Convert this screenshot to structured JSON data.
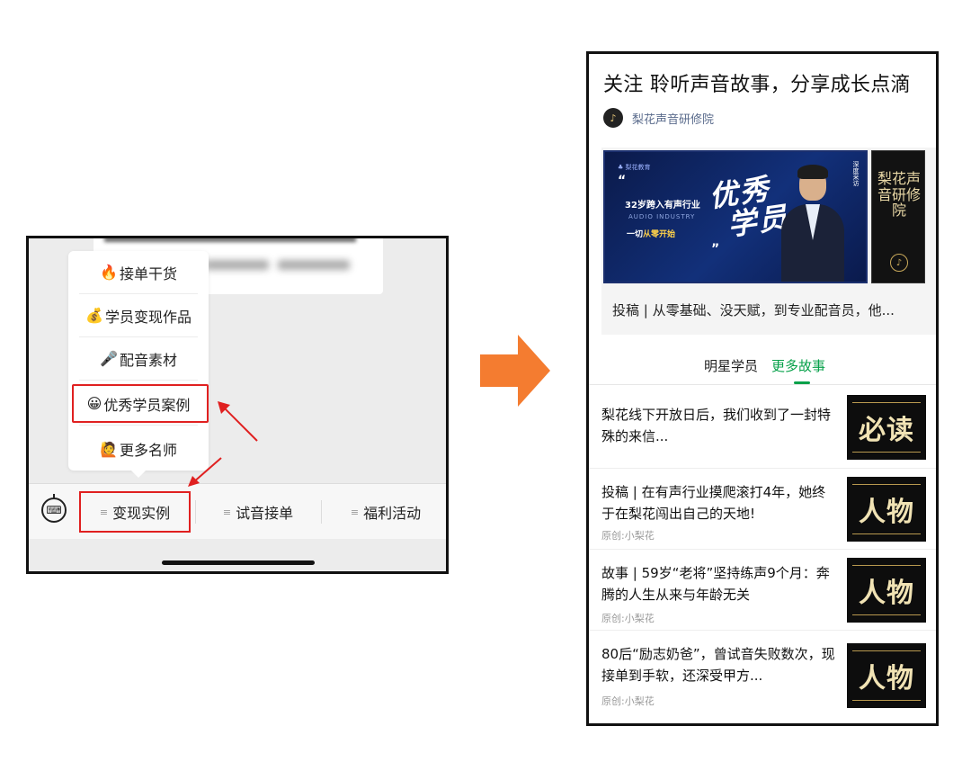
{
  "left_panel": {
    "menu_items": [
      {
        "icon": "🔥",
        "icon_name": "fire-icon",
        "label": "接单干货"
      },
      {
        "icon": "💰",
        "icon_name": "money-bag-icon",
        "label": "学员变现作品"
      },
      {
        "icon": "🎤",
        "icon_name": "microphone-icon",
        "label": "配音素材"
      },
      {
        "icon": "😀",
        "icon_name": "grinning-face-icon",
        "label": "优秀学员案例"
      },
      {
        "icon": "🙋",
        "icon_name": "person-raising-hand-icon",
        "label": "更多名师"
      }
    ],
    "bottom_tabs": [
      {
        "prefix": "≡",
        "label": "变现实例"
      },
      {
        "prefix": "≡",
        "label": "试音接单"
      },
      {
        "prefix": "≡",
        "label": "福利活动"
      }
    ],
    "keyboard_icon": "⌨"
  },
  "right_panel": {
    "article_title": "关注 聆听声音故事，分享成长点滴",
    "author": "梨花声音研修院",
    "author_avatar_glyph": "♪",
    "banner": {
      "logo_text": "♣ 梨花教育",
      "quote_open": "“",
      "line1": "32岁跨入有声行业",
      "line2": "AUDIO INDUSTRY",
      "line3_prefix": "一切",
      "line3_highlight": "从零开始",
      "quote_close": "”",
      "big_text_1": "优秀",
      "big_text_2": "学员",
      "vertical_text": "深度采访",
      "side_text": "梨花声音研修院",
      "side_logo": "♪",
      "caption": "投稿 | 从零基础、没天赋，到专业配音员，他..."
    },
    "tabs": [
      "明星学员",
      "更多故事"
    ],
    "articles": [
      {
        "title": "梨花线下开放日后，我们收到了一封特殊的来信...",
        "source": "",
        "thumb_text": "必读"
      },
      {
        "title": "投稿 | 在有声行业摸爬滚打4年，她终于在梨花闯出自己的天地!",
        "source": "原创:小梨花",
        "thumb_text": "人物"
      },
      {
        "title": "故事 | 59岁“老将”坚持练声9个月：奔腾的人生从来与年龄无关",
        "source": "原创:小梨花",
        "thumb_text": "人物"
      },
      {
        "title": "80后“励志奶爸”，曾试音失败数次，现接单到手软，还深受甲方...",
        "source": "原创:小梨花",
        "thumb_text": "人物"
      }
    ]
  },
  "colors": {
    "highlight_red": "#e02020",
    "arrow_orange": "#f47c30",
    "accent_green": "#07a14a",
    "banner_blue": "#12307a",
    "thumb_gold": "#f1e3b4"
  }
}
